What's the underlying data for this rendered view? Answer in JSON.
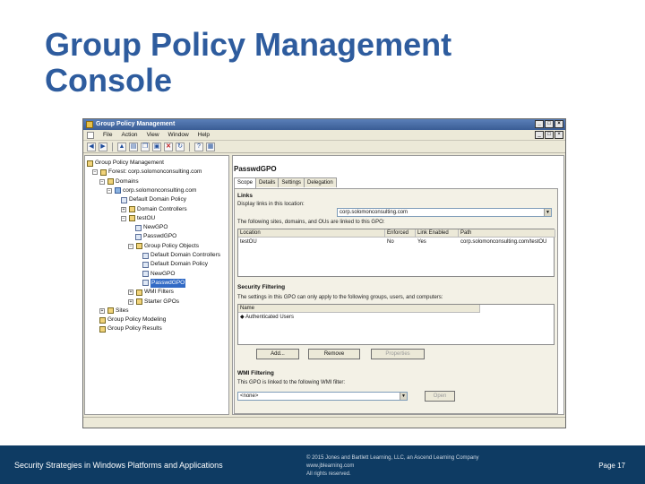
{
  "slide": {
    "title_line1": "Group Policy Management",
    "title_line2": "Console"
  },
  "window": {
    "title": "Group Policy Management",
    "controls": [
      "_",
      "□",
      "×"
    ],
    "menu": [
      "File",
      "Action",
      "View",
      "Window",
      "Help"
    ],
    "toolbar_icons": [
      "back-icon",
      "forward-icon",
      "folder-up-icon",
      "properties-icon",
      "copy-icon",
      "paste-icon",
      "delete-icon",
      "refresh-icon",
      "help-icon",
      "console-icon"
    ]
  },
  "tree": [
    {
      "label": "Group Policy Management",
      "icon": "gpm-icon",
      "exp": ""
    },
    {
      "label": "Forest: corp.solomonconsulting.com",
      "icon": "forest-icon",
      "exp": "−"
    },
    {
      "label": "Domains",
      "icon": "folder-icon",
      "exp": "−"
    },
    {
      "label": "corp.solomonconsulting.com",
      "icon": "domain-icon",
      "exp": "−"
    },
    {
      "label": "Default Domain Policy",
      "icon": "gpo-link-icon",
      "exp": ""
    },
    {
      "label": "Domain Controllers",
      "icon": "ou-icon",
      "exp": "+"
    },
    {
      "label": "testOU",
      "icon": "ou-icon",
      "exp": "−"
    },
    {
      "label": "NewGPO",
      "icon": "gpo-link-icon",
      "exp": ""
    },
    {
      "label": "PasswdGPO",
      "icon": "gpo-link-icon",
      "exp": ""
    },
    {
      "label": "Group Policy Objects",
      "icon": "folder-icon",
      "exp": "−"
    },
    {
      "label": "Default Domain Controllers",
      "icon": "gpo-icon",
      "exp": ""
    },
    {
      "label": "Default Domain Policy",
      "icon": "gpo-icon",
      "exp": ""
    },
    {
      "label": "NewGPO",
      "icon": "gpo-icon",
      "exp": ""
    },
    {
      "label": "PasswdGPO",
      "icon": "gpo-icon",
      "exp": ""
    },
    {
      "label": "WMI Filters",
      "icon": "folder-icon",
      "exp": "+"
    },
    {
      "label": "Starter GPOs",
      "icon": "folder-icon",
      "exp": "+"
    },
    {
      "label": "Sites",
      "icon": "sites-icon",
      "exp": "+"
    },
    {
      "label": "Group Policy Modeling",
      "icon": "modeling-icon",
      "exp": ""
    },
    {
      "label": "Group Policy Results",
      "icon": "results-icon",
      "exp": ""
    }
  ],
  "detail": {
    "gpo_name": "PasswdGPO",
    "tabs": [
      "Scope",
      "Details",
      "Settings",
      "Delegation"
    ],
    "links": {
      "heading": "Links",
      "display_label": "Display links in this location:",
      "location_value": "corp.solomonconsulting.com",
      "info": "The following sites, domains, and OUs are linked to this GPO:",
      "columns": [
        "Location",
        "Enforced",
        "Link Enabled",
        "Path"
      ],
      "rows": [
        [
          "testOU",
          "No",
          "Yes",
          "corp.solomonconsulting.com/testOU"
        ]
      ]
    },
    "security": {
      "heading": "Security Filtering",
      "info": "The settings in this GPO can only apply to the following groups, users, and computers:",
      "column": "Name",
      "rows": [
        "Authenticated Users"
      ],
      "buttons": [
        "Add...",
        "Remove",
        "Properties"
      ]
    },
    "wmi": {
      "heading": "WMI Filtering",
      "info": "This GPO is linked to the following WMI filter:",
      "value": "<none>",
      "button": "Open"
    }
  },
  "footer": {
    "left": "Security Strategies in Windows Platforms and Applications",
    "copyright": "© 2015 Jones and Bartlett Learning, LLC, an Ascend Learning Company",
    "site": "www.jblearning.com",
    "rights": "All rights reserved.",
    "page": "Page 17"
  }
}
